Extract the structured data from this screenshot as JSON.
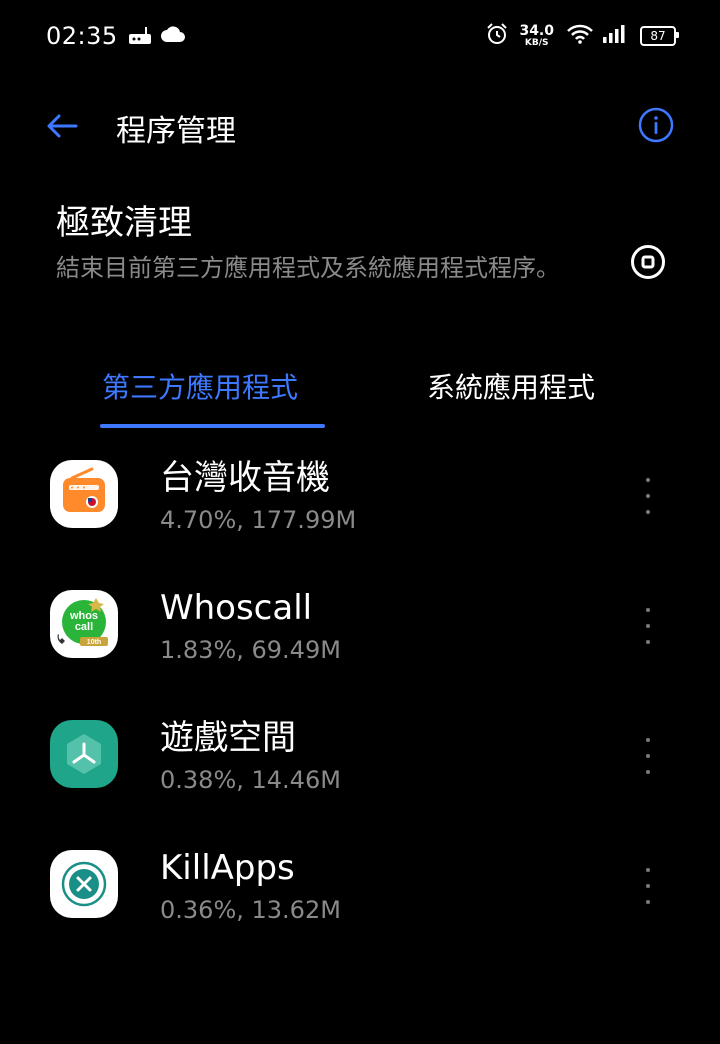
{
  "status_bar": {
    "time": "02:35",
    "net_speed_value": "34.0",
    "net_speed_unit": "KB/S",
    "battery_level": "87",
    "icons": [
      "router-icon",
      "cloud-icon",
      "alarm-icon",
      "wifi-icon",
      "signal-icon",
      "battery-icon"
    ]
  },
  "app_bar": {
    "title": "程序管理",
    "back_icon": "back-arrow-icon",
    "info_icon": "info-icon"
  },
  "deep_clean": {
    "title": "極致清理",
    "description": "結束目前第三方應用程式及系統應用程式程序。",
    "action_icon": "stop-icon"
  },
  "tabs": [
    {
      "label": "第三方應用程式",
      "selected": true
    },
    {
      "label": "系統應用程式",
      "selected": false
    }
  ],
  "apps": [
    {
      "name": "台灣收音機",
      "stats": "4.70%, 177.99M",
      "icon": "radio-app-icon"
    },
    {
      "name": "Whoscall",
      "stats": "1.83%, 69.49M",
      "icon": "whoscall-app-icon",
      "icon_text": [
        "whos",
        "call",
        "10th"
      ]
    },
    {
      "name": "遊戲空間",
      "stats": "0.38%, 14.46M",
      "icon": "game-space-app-icon"
    },
    {
      "name": "KillApps",
      "stats": "0.36%, 13.62M",
      "icon": "killapps-app-icon"
    }
  ],
  "colors": {
    "accent": "#3d78ff",
    "background": "#000000",
    "secondary_text": "#8a8a8a"
  }
}
